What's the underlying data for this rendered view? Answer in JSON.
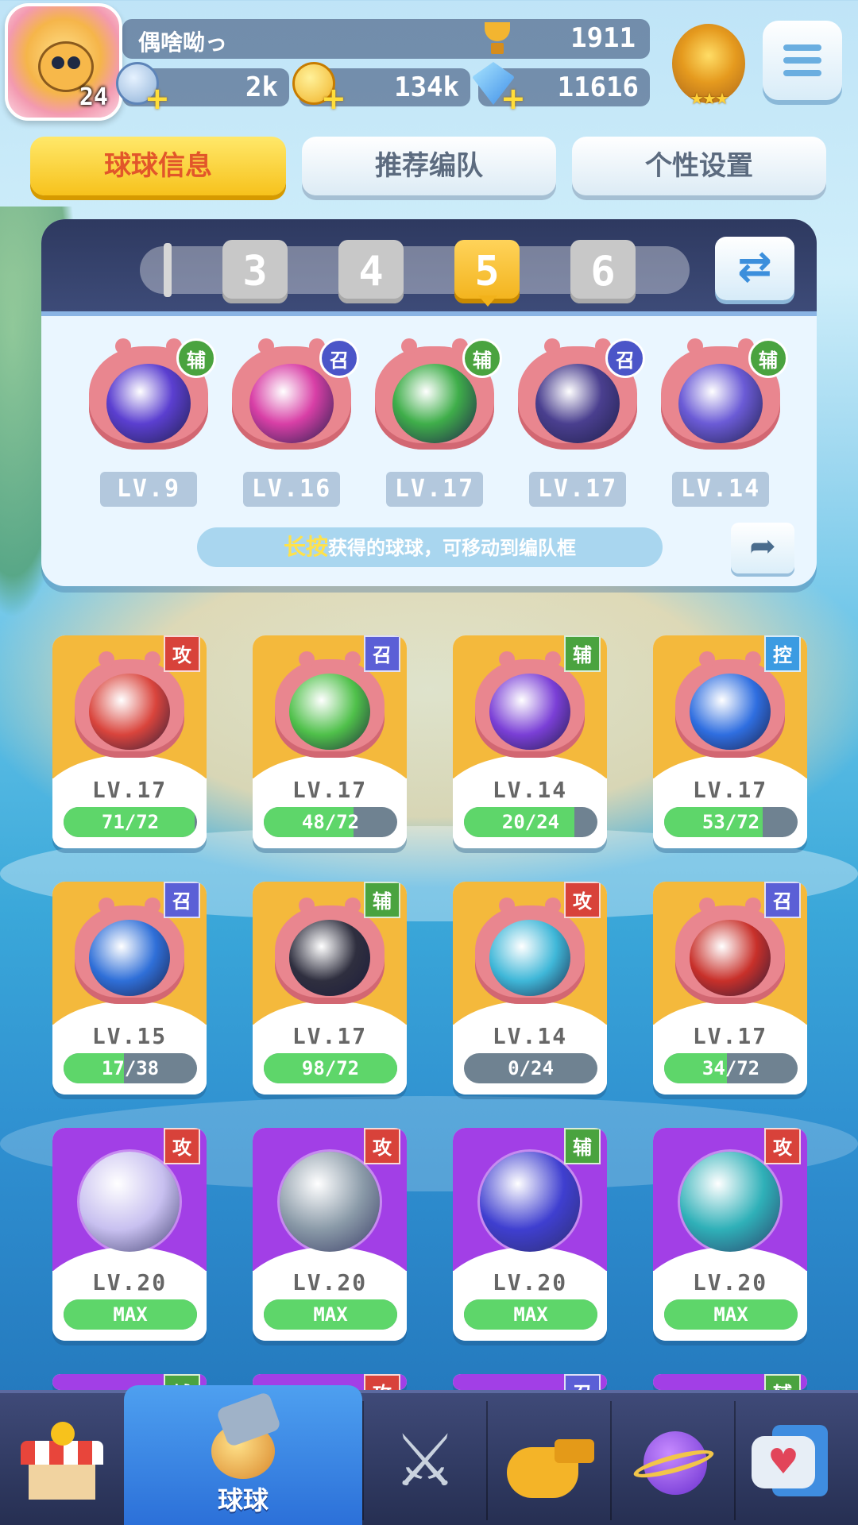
{
  "player": {
    "name": "偶啥呦っ",
    "level": "24",
    "trophies": "1911",
    "rank_stars": "★★★"
  },
  "resources": {
    "stars": "2k",
    "gold": "134k",
    "diamonds": "11616"
  },
  "tabs": [
    {
      "label": "球球信息",
      "active": true
    },
    {
      "label": "推荐编队",
      "active": false
    },
    {
      "label": "个性设置",
      "active": false
    }
  ],
  "team_slots": [
    "3",
    "4",
    "5",
    "6"
  ],
  "active_slot": "5",
  "team": [
    {
      "level": "LV.9",
      "tag": "辅",
      "color": "#5b3fd0",
      "icon": "lightning-icon"
    },
    {
      "level": "LV.16",
      "tag": "召",
      "color": "#d83fa6",
      "icon": "dagger-icon"
    },
    {
      "level": "LV.17",
      "tag": "辅",
      "color": "#3fae4a",
      "icon": "star-arrow-icon"
    },
    {
      "level": "LV.17",
      "tag": "召",
      "color": "#4a3f8f",
      "icon": "ghost-icon"
    },
    {
      "level": "LV.14",
      "tag": "辅",
      "color": "#6b5bd6",
      "icon": "crowd-icon"
    }
  ],
  "hint": {
    "highlight": "长按",
    "text": "获得的球球，可移动到编队框"
  },
  "cards": [
    {
      "tag": "攻",
      "tag_type": "gong",
      "level": "LV.17",
      "progress": "71/72",
      "fill": 0.98,
      "theme": "gold",
      "color": "#d9443c",
      "icon": "fist-icon"
    },
    {
      "tag": "召",
      "tag_type": "zhao",
      "level": "LV.17",
      "progress": "48/72",
      "fill": 0.67,
      "theme": "gold",
      "color": "#4fc04a",
      "icon": "star-circle-icon"
    },
    {
      "tag": "辅",
      "tag_type": "fu",
      "level": "LV.14",
      "progress": "20/24",
      "fill": 0.83,
      "theme": "gold",
      "color": "#7a3fd6",
      "icon": "sprout-icon"
    },
    {
      "tag": "控",
      "tag_type": "kong",
      "level": "LV.17",
      "progress": "53/72",
      "fill": 0.74,
      "theme": "gold",
      "color": "#2f6ee0",
      "icon": "snowflake-icon"
    },
    {
      "tag": "召",
      "tag_type": "zhao",
      "level": "LV.15",
      "progress": "17/38",
      "fill": 0.45,
      "theme": "gold",
      "color": "#2f6fd8",
      "icon": "ice-castle-icon"
    },
    {
      "tag": "辅",
      "tag_type": "fu",
      "level": "LV.17",
      "progress": "98/72",
      "fill": 1.0,
      "theme": "gold",
      "color": "#2f2f3f",
      "icon": "skull-icon"
    },
    {
      "tag": "攻",
      "tag_type": "gong",
      "level": "LV.14",
      "progress": "0/24",
      "fill": 0.0,
      "theme": "gold",
      "color": "#3fb7d8",
      "icon": "tornado-icon"
    },
    {
      "tag": "召",
      "tag_type": "zhao",
      "level": "LV.17",
      "progress": "34/72",
      "fill": 0.47,
      "theme": "gold",
      "color": "#c8302a",
      "icon": "cannon-icon"
    },
    {
      "tag": "攻",
      "tag_type": "gong",
      "level": "LV.20",
      "progress": "MAX",
      "fill": 1.0,
      "theme": "purple",
      "color": "#c8c0f0",
      "icon": "bubble-icon"
    },
    {
      "tag": "攻",
      "tag_type": "gong",
      "level": "LV.20",
      "progress": "MAX",
      "fill": 1.0,
      "theme": "purple",
      "color": "#8a9aa8",
      "icon": "vortex-icon"
    },
    {
      "tag": "辅",
      "tag_type": "fu",
      "level": "LV.20",
      "progress": "MAX",
      "fill": 1.0,
      "theme": "purple",
      "color": "#3f3fd0",
      "icon": "swap-arrow-icon"
    },
    {
      "tag": "攻",
      "tag_type": "gong",
      "level": "LV.20",
      "progress": "MAX",
      "fill": 1.0,
      "theme": "purple",
      "color": "#2fb0b8",
      "icon": "swirl-icon"
    }
  ],
  "partial_row_tags": [
    "辅",
    "攻",
    "召",
    "辅"
  ],
  "bottom_nav": [
    {
      "id": "shop",
      "label": "",
      "icon": "shop-icon"
    },
    {
      "id": "balls",
      "label": "球球",
      "icon": "ball-bucket-icon",
      "active": true
    },
    {
      "id": "battle",
      "label": "",
      "icon": "crossed-swords-icon"
    },
    {
      "id": "whistle",
      "label": "",
      "icon": "whistle-icon"
    },
    {
      "id": "planet",
      "label": "",
      "icon": "planet-icon"
    },
    {
      "id": "social",
      "label": "",
      "icon": "heart-chat-icon"
    }
  ]
}
